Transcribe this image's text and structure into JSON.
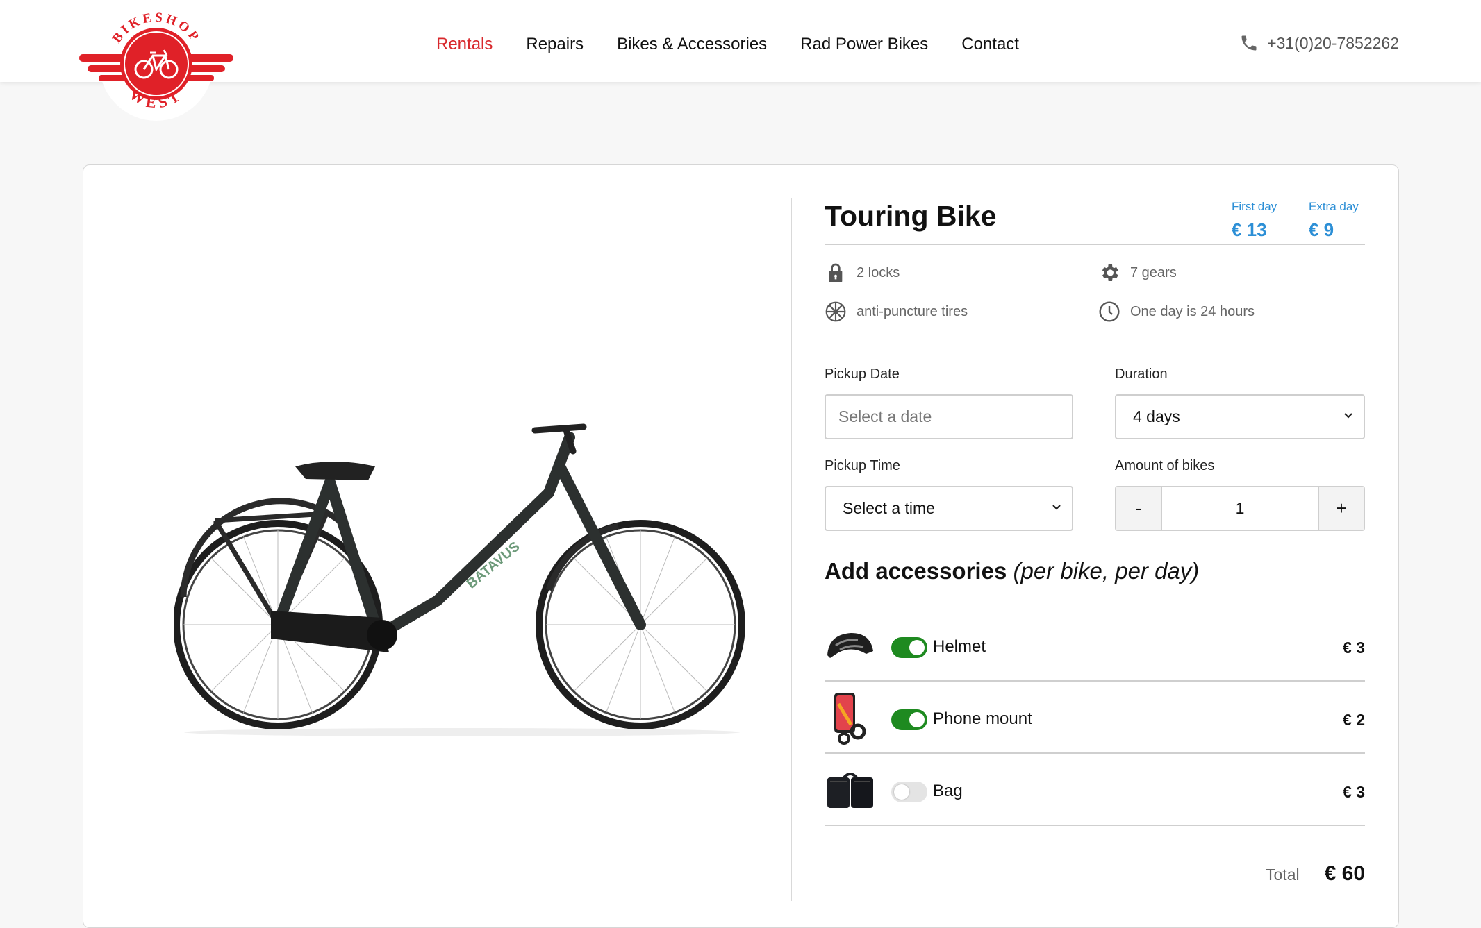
{
  "brand": {
    "logo_top": "BIKESHOP",
    "logo_bottom": "WEST",
    "primary_color": "#e02128"
  },
  "nav": {
    "items": [
      {
        "label": "Rentals",
        "active": true
      },
      {
        "label": "Repairs"
      },
      {
        "label": "Bikes & Accessories"
      },
      {
        "label": "Rad Power Bikes"
      },
      {
        "label": "Contact"
      }
    ]
  },
  "contact": {
    "phone": "+31(0)20-7852262",
    "icon": "phone-icon"
  },
  "product": {
    "title": "Touring Bike",
    "bike_brand": "BATAVUS",
    "first_day_label": "First day",
    "first_day_price": "€ 13",
    "extra_day_label": "Extra day",
    "extra_day_price": "€ 9",
    "features": [
      {
        "icon": "lock-icon",
        "text": "2 locks"
      },
      {
        "icon": "gear-icon",
        "text": "7 gears"
      },
      {
        "icon": "wheel-icon",
        "text": "anti-puncture tires"
      },
      {
        "icon": "clock-icon",
        "text": "One day is 24 hours"
      }
    ]
  },
  "form": {
    "pickup_date_label": "Pickup Date",
    "pickup_date_placeholder": "Select a date",
    "duration_label": "Duration",
    "duration_value": "4 days",
    "pickup_time_label": "Pickup Time",
    "pickup_time_value": "Select a time",
    "amount_label": "Amount of bikes",
    "amount_minus": "-",
    "amount_value": "1",
    "amount_plus": "+"
  },
  "accessories": {
    "heading": "Add accessories",
    "heading_suffix": "(per bike, per day)",
    "items": [
      {
        "name": "Helmet",
        "price": "€ 3",
        "enabled": true,
        "icon": "helmet-icon"
      },
      {
        "name": "Phone mount",
        "price": "€ 2",
        "enabled": true,
        "icon": "phone-mount-icon"
      },
      {
        "name": "Bag",
        "price": "€ 3",
        "enabled": false,
        "icon": "bag-icon"
      }
    ]
  },
  "summary": {
    "total_label": "Total",
    "total_value": "€ 60"
  }
}
